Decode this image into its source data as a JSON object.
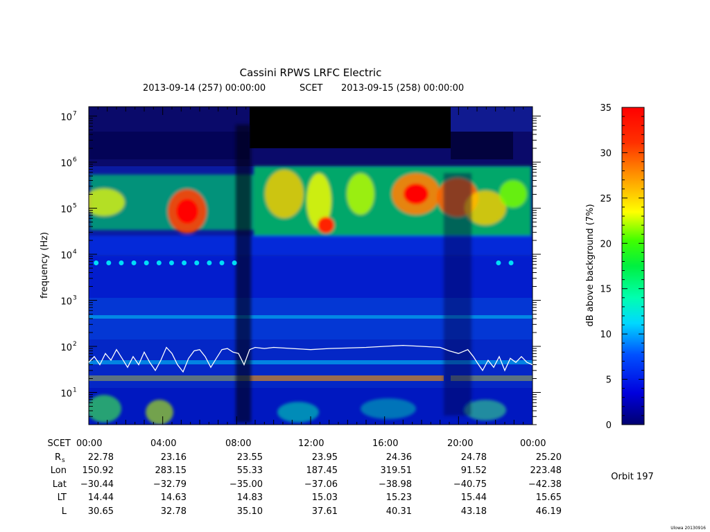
{
  "chart_data": {
    "type": "heatmap",
    "title": "Cassini RPWS LRFC Electric",
    "subtitle": {
      "start": "2013-09-14 (257) 00:00:00",
      "mid": "SCET",
      "end": "2013-09-15 (258) 00:00:00"
    },
    "ylabel": "frequency (Hz)",
    "y_scale": "log",
    "ylim": [
      2,
      16000000
    ],
    "y_ticks": [
      {
        "exp": "7",
        "value": 10000000
      },
      {
        "exp": "6",
        "value": 1000000
      },
      {
        "exp": "5",
        "value": 100000
      },
      {
        "exp": "4",
        "value": 10000
      },
      {
        "exp": "3",
        "value": 1000
      },
      {
        "exp": "2",
        "value": 100
      },
      {
        "exp": "1",
        "value": 10
      }
    ],
    "y_tick_base": "10",
    "xlim": [
      0,
      24
    ],
    "x_ticks": [
      0,
      4,
      8,
      12,
      16,
      20,
      24
    ],
    "ephemeris": {
      "labels": [
        "SCET",
        "Rs",
        "Lon",
        "Lat",
        "LT",
        "L"
      ],
      "rs_sub": "s",
      "rs_main": "R",
      "rows": {
        "SCET": [
          "00:00",
          "04:00",
          "08:00",
          "12:00",
          "16:00",
          "20:00",
          "00:00"
        ],
        "Rs": [
          "22.78",
          "23.16",
          "23.55",
          "23.95",
          "24.36",
          "24.78",
          "25.20"
        ],
        "Lon": [
          "150.92",
          "283.15",
          "55.33",
          "187.45",
          "319.51",
          "91.52",
          "223.48"
        ],
        "Lat": [
          "−30.44",
          "−32.79",
          "−35.00",
          "−37.06",
          "−38.98",
          "−40.75",
          "−42.38"
        ],
        "LT": [
          "14.44",
          "14.63",
          "14.83",
          "15.03",
          "15.23",
          "15.44",
          "15.65"
        ],
        "L": [
          "30.65",
          "32.78",
          "35.10",
          "37.61",
          "40.31",
          "43.18",
          "46.19"
        ]
      }
    },
    "colorbar": {
      "label": "dB above background (7%)",
      "range": [
        0,
        35
      ],
      "ticks": [
        0,
        5,
        10,
        15,
        20,
        25,
        30,
        35
      ],
      "colors": [
        "#000080",
        "#0000ff",
        "#00bfff",
        "#00ffff",
        "#00ff40",
        "#c0ff00",
        "#ffff00",
        "#ff9900",
        "#ff3000",
        "#ff0000"
      ]
    },
    "orbit_label": "Orbit 197",
    "footer": "Ulowa 20130916",
    "fce_line": {
      "color": "#ffffff",
      "points": [
        [
          0,
          45
        ],
        [
          0.3,
          60
        ],
        [
          0.6,
          40
        ],
        [
          0.9,
          70
        ],
        [
          1.2,
          50
        ],
        [
          1.5,
          85
        ],
        [
          1.8,
          55
        ],
        [
          2.1,
          35
        ],
        [
          2.4,
          60
        ],
        [
          2.7,
          40
        ],
        [
          3.0,
          75
        ],
        [
          3.3,
          45
        ],
        [
          3.6,
          30
        ],
        [
          3.9,
          50
        ],
        [
          4.2,
          95
        ],
        [
          4.5,
          70
        ],
        [
          4.8,
          40
        ],
        [
          5.1,
          28
        ],
        [
          5.4,
          55
        ],
        [
          5.7,
          80
        ],
        [
          6.0,
          85
        ],
        [
          6.3,
          60
        ],
        [
          6.6,
          35
        ],
        [
          6.9,
          55
        ],
        [
          7.2,
          85
        ],
        [
          7.5,
          90
        ],
        [
          7.8,
          75
        ],
        [
          8.1,
          70
        ],
        [
          8.4,
          40
        ],
        [
          8.7,
          85
        ],
        [
          9.0,
          95
        ],
        [
          9.5,
          90
        ],
        [
          10,
          95
        ],
        [
          11,
          90
        ],
        [
          12,
          85
        ],
        [
          13,
          90
        ],
        [
          14,
          92
        ],
        [
          15,
          95
        ],
        [
          16,
          100
        ],
        [
          17,
          105
        ],
        [
          18,
          100
        ],
        [
          19,
          95
        ],
        [
          19.5,
          80
        ],
        [
          20,
          70
        ],
        [
          20.5,
          85
        ],
        [
          20.8,
          60
        ],
        [
          21.0,
          45
        ],
        [
          21.3,
          30
        ],
        [
          21.6,
          50
        ],
        [
          21.9,
          35
        ],
        [
          22.2,
          60
        ],
        [
          22.5,
          30
        ],
        [
          22.8,
          55
        ],
        [
          23.1,
          45
        ],
        [
          23.4,
          60
        ],
        [
          23.7,
          45
        ],
        [
          24,
          40
        ]
      ]
    }
  }
}
